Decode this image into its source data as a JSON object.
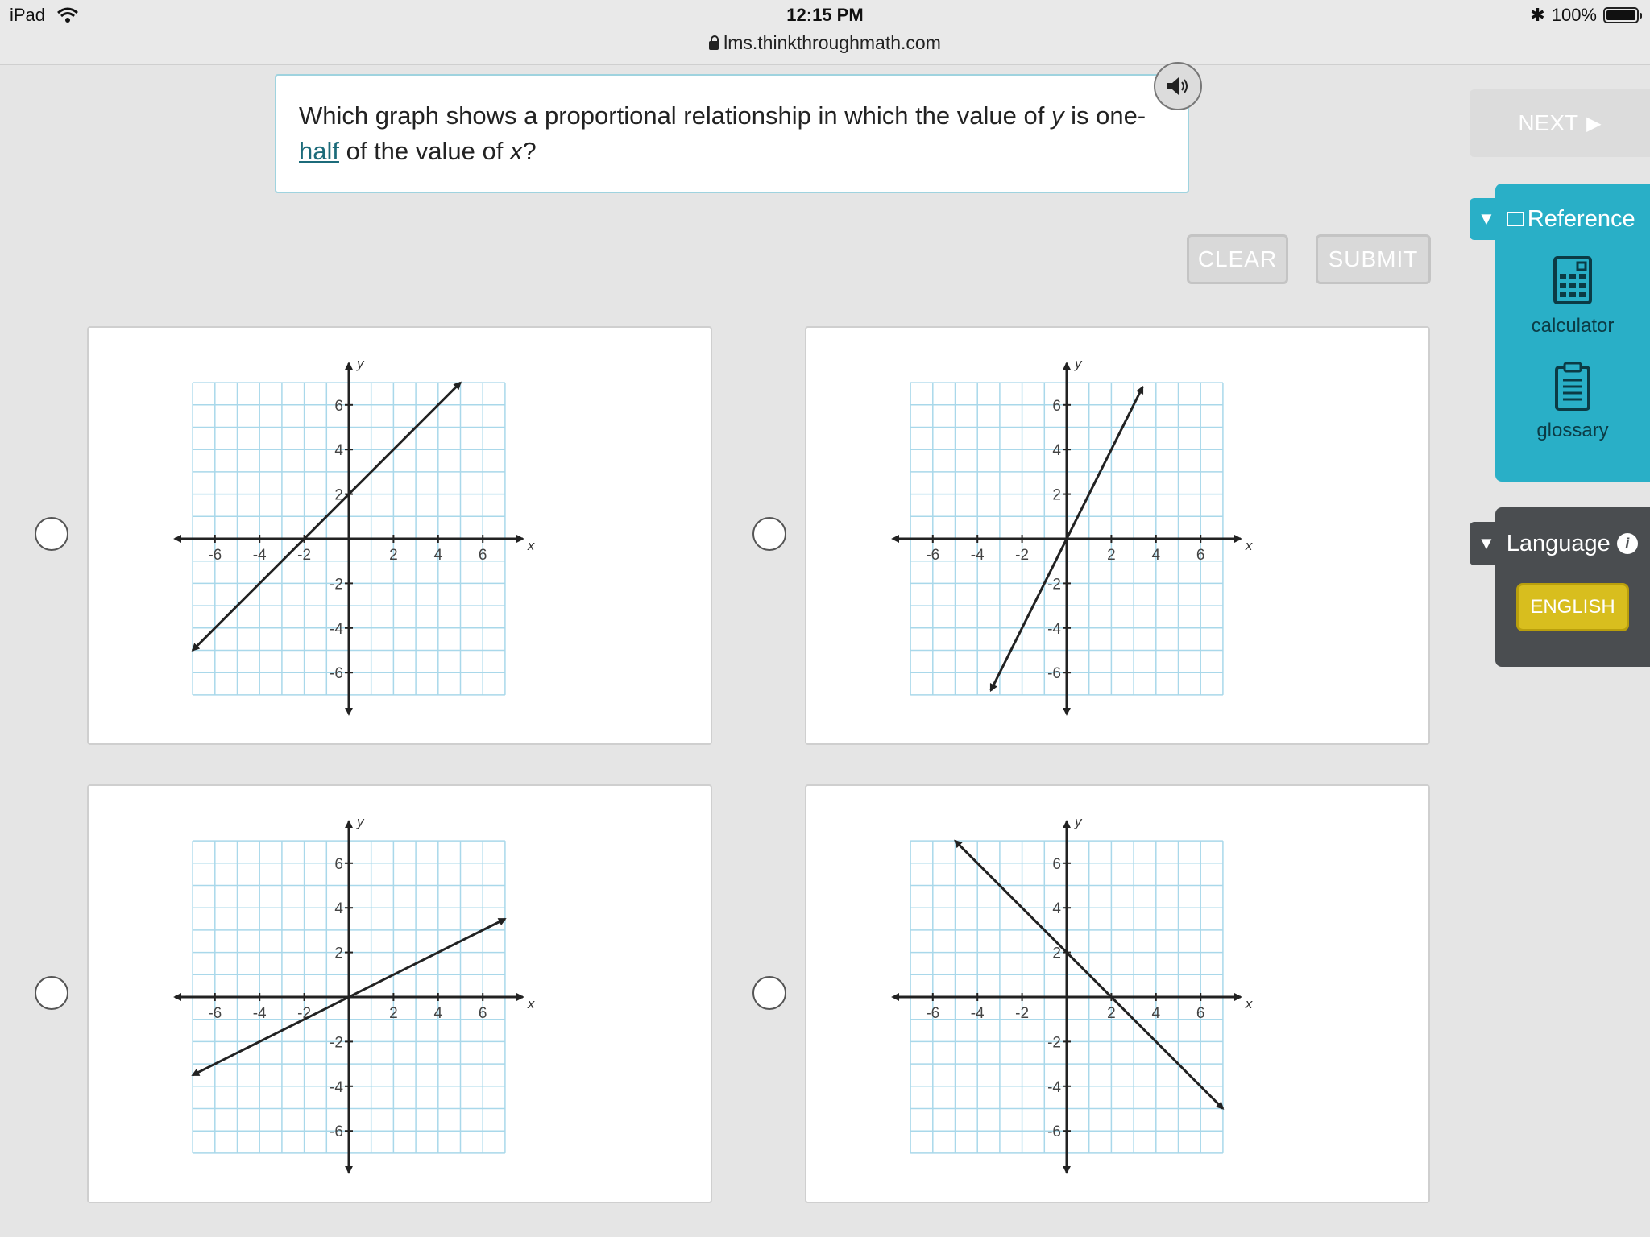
{
  "status_bar": {
    "device": "iPad",
    "time": "12:15 PM",
    "url": "lms.thinkthroughmath.com",
    "battery": "100%"
  },
  "question": {
    "part1": "Which graph shows a proportional relationship in which the value of ",
    "var_y": "y",
    "part2": " is one-",
    "link": "half",
    "part3": " of the value of ",
    "var_x": "x",
    "part4": "?"
  },
  "buttons": {
    "clear": "CLEAR",
    "submit": "SUBMIT",
    "next": "NEXT"
  },
  "sidebar": {
    "reference_title": "Reference",
    "tools": [
      "calculator",
      "glossary"
    ],
    "language_title": "Language",
    "language_value": "ENGLISH"
  },
  "graphs": {
    "axis_x_label": "x",
    "axis_y_label": "y",
    "tick_labels": [
      "-6",
      "-4",
      "-2",
      "2",
      "4",
      "6"
    ],
    "grid_range": [
      -7,
      7
    ],
    "colors": {
      "grid": "#a9d8ea",
      "axis": "#222222"
    },
    "options": [
      {
        "name": "option-a",
        "line": {
          "slope": 1,
          "intercept": 2,
          "x_range": [
            -7,
            5
          ]
        }
      },
      {
        "name": "option-b",
        "line": {
          "slope": 2,
          "intercept": 0,
          "x_range": [
            -3.4,
            3.4
          ]
        }
      },
      {
        "name": "option-c",
        "line": {
          "slope": 0.5,
          "intercept": 0,
          "x_range": [
            -7,
            7
          ]
        }
      },
      {
        "name": "option-d",
        "line": {
          "slope": -1,
          "intercept": 2,
          "x_range": [
            -5,
            7
          ]
        }
      }
    ]
  }
}
